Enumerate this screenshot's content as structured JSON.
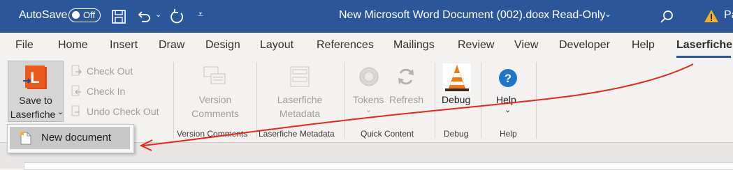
{
  "titlebar": {
    "autosave_label": "AutoSave",
    "autosave_state": "Off",
    "document_title": "New Microsoft Word Document (002).docx",
    "read_only": "Read-Only",
    "user_initials": "Pa"
  },
  "tabs": [
    "File",
    "Home",
    "Insert",
    "Draw",
    "Design",
    "Layout",
    "References",
    "Mailings",
    "Review",
    "View",
    "Developer",
    "Help",
    "Laserfiche"
  ],
  "active_tab": "Laserfiche",
  "ribbon": {
    "save_line1": "Save to",
    "save_line2": "Laserfiche",
    "check_out": "Check Out",
    "check_in": "Check In",
    "undo_check_out": "Undo Check Out",
    "version_line1": "Version",
    "version_line2": "Comments",
    "metadata_line1": "Laserfiche",
    "metadata_line2": "Metadata",
    "tokens": "Tokens",
    "refresh": "Refresh",
    "debug": "Debug",
    "help": "Help",
    "groups": {
      "version_comments": "Version Comments",
      "laserfiche_metadata": "Laserfiche Metadata",
      "quick_content": "Quick Content",
      "debug": "Debug",
      "help": "Help"
    }
  },
  "dropdown": {
    "new_document": "New document"
  },
  "colors": {
    "title_bar": "#2b579a",
    "laserfiche_orange": "#e04a14",
    "help_blue": "#1e74c8",
    "annotation_red": "#e8261b"
  },
  "icons": [
    "save-icon",
    "undo-icon",
    "redo-icon",
    "customize-icon",
    "search-icon",
    "warning-icon",
    "laserfiche-icon",
    "check-out-icon",
    "check-in-icon",
    "undo-check-out-icon",
    "version-comments-icon",
    "metadata-icon",
    "tokens-icon",
    "refresh-icon",
    "debug-cone-icon",
    "help-icon",
    "new-document-icon"
  ]
}
